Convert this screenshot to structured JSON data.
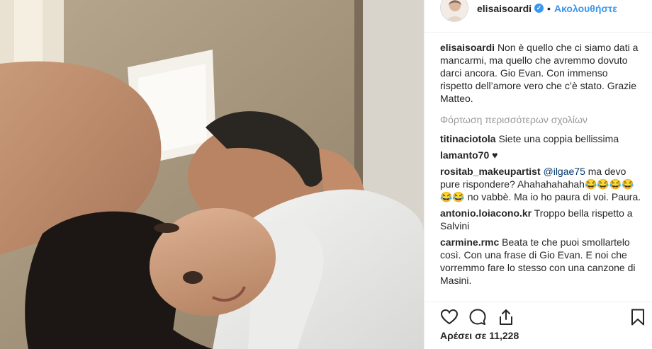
{
  "post": {
    "username": "elisaisoardi",
    "verified_mark": "✓",
    "separator": "•",
    "follow_label": "Ακολουθήστε"
  },
  "caption": {
    "user": "elisaisoardi",
    "text": "Non è quello che ci siamo dati a mancarmi, ma quello che avremmo dovuto darci ancora. Gio Evan. Con immenso rispetto dell’amore vero che c’è stato. Grazie Matteo."
  },
  "load_more_label": "Φόρτωση περισσότερων σχολίων",
  "comments": [
    {
      "user": "titinaciotola",
      "mention": "",
      "text": "Siete una coppia bellissima"
    },
    {
      "user": "lamanto70",
      "mention": "",
      "text": "♥"
    },
    {
      "user": "rositab_makeupartist",
      "mention": "@ilgae75",
      "text": "ma devo pure rispondere? Ahahahahahah😂😂😂😂😂😂 no vabbè. Ma io ho paura di voi. Paura."
    },
    {
      "user": "antonio.loiacono.kr",
      "mention": "",
      "text": "Troppo bella rispetto a Salvini"
    },
    {
      "user": "carmine.rmc",
      "mention": "",
      "text": "Beata te che puoi smollartelo così. Con una frase di Gio Evan. E noi che vorremmo fare lo stesso con una canzone di Masini."
    }
  ],
  "actions": {
    "like_icon": "heart-icon",
    "comment_icon": "comment-icon",
    "share_icon": "share-icon",
    "save_icon": "bookmark-icon"
  },
  "likes_text": "Αρέσει σε 11,228",
  "colors": {
    "link_blue": "#3897f0",
    "mention_blue": "#003569",
    "muted_gray": "#999999",
    "text_dark": "#262626"
  }
}
